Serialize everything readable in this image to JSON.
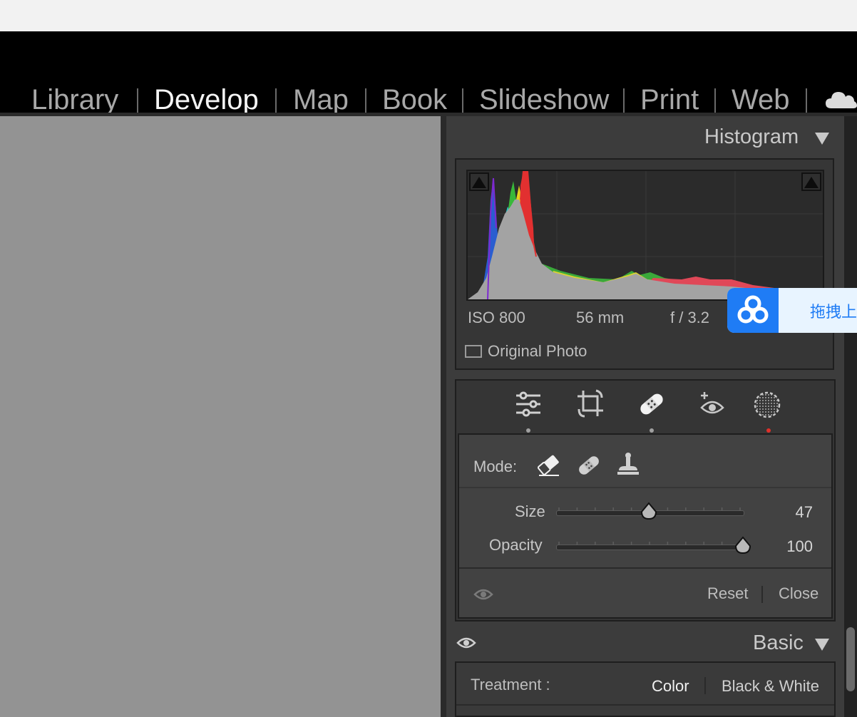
{
  "modules": {
    "items": [
      "Library",
      "Develop",
      "Map",
      "Book",
      "Slideshow",
      "Print",
      "Web"
    ],
    "active": "Develop"
  },
  "histogram": {
    "title": "Histogram",
    "iso": "ISO 800",
    "focal_length": "56 mm",
    "aperture": "f / 3.2",
    "original_photo_label": "Original Photo"
  },
  "tools": {
    "strip": [
      "edit-sliders-icon",
      "crop-icon",
      "healing-icon",
      "red-eye-icon",
      "masking-icon"
    ],
    "active_tool": "healing-icon"
  },
  "spot_removal": {
    "mode_label": "Mode:",
    "modes": [
      "content-aware-remove-icon",
      "heal-icon",
      "clone-icon"
    ],
    "size_label": "Size",
    "size_value": "47",
    "size_fraction": 0.47,
    "opacity_label": "Opacity",
    "opacity_value": "100",
    "opacity_fraction": 1.0,
    "reset_label": "Reset",
    "close_label": "Close"
  },
  "basic": {
    "title": "Basic",
    "treatment_label": "Treatment :",
    "color_option": "Color",
    "bw_option": "Black & White"
  },
  "overlay": {
    "baidu_text": "拖拽上"
  },
  "colors": {
    "accent_red": "#e0302a",
    "baidu_blue": "#1f7cf5"
  }
}
